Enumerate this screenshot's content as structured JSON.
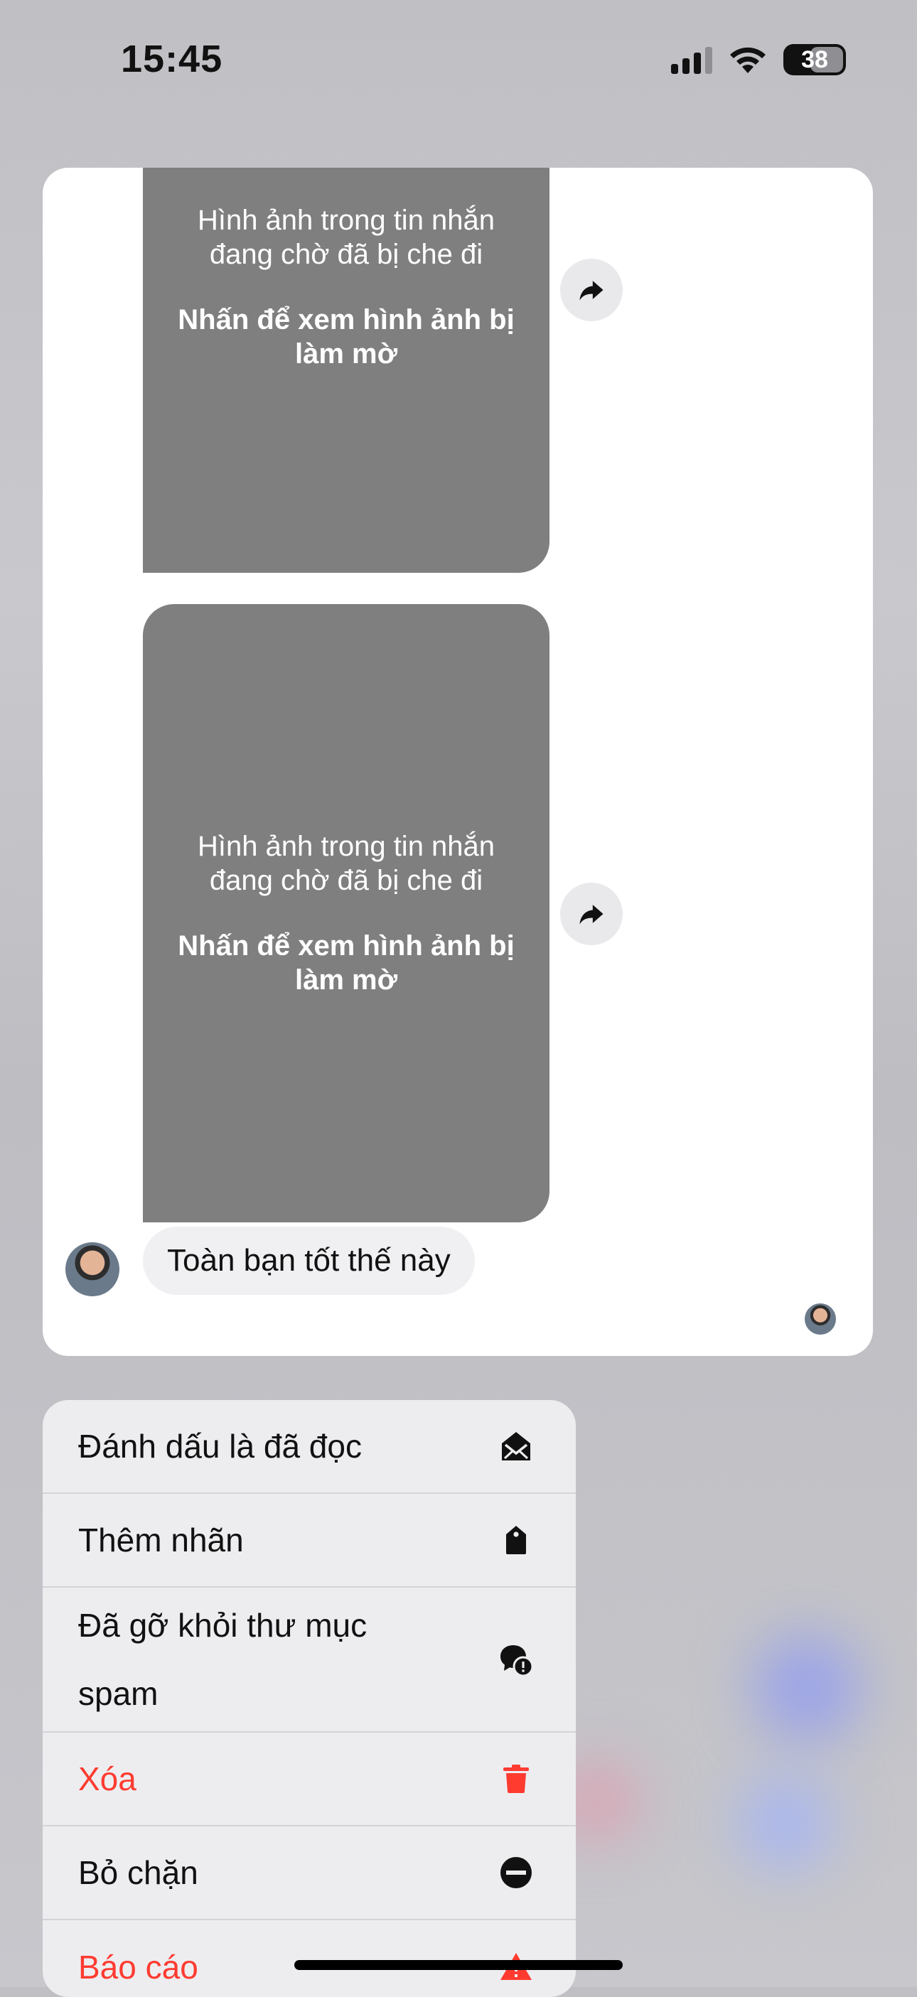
{
  "status_bar": {
    "time": "15:45",
    "battery_level": "38"
  },
  "preview": {
    "blurred_images": [
      {
        "note": "Hình ảnh trong tin nhắn đang chờ đã bị che đi",
        "action": "Nhấn để xem hình ảnh bị làm mờ"
      },
      {
        "note": "Hình ảnh trong tin nhắn đang chờ đã bị che đi",
        "action": "Nhấn để xem hình ảnh bị làm mờ"
      }
    ],
    "text_message": "Toàn bạn tốt thế này"
  },
  "menu": {
    "items": [
      {
        "label": "Đánh dấu là đã đọc",
        "icon": "envelope-open-icon",
        "destructive": false
      },
      {
        "label": "Thêm nhãn",
        "icon": "tag-icon",
        "destructive": false
      },
      {
        "label": "Đã gỡ khỏi thư mục spam",
        "icon": "chat-bubble-alert-icon",
        "destructive": false
      },
      {
        "label": "Xóa",
        "icon": "trash-icon",
        "destructive": true
      },
      {
        "label": "Bỏ chặn",
        "icon": "minus-circle-icon",
        "destructive": false
      },
      {
        "label": "Báo cáo",
        "icon": "warning-triangle-icon",
        "destructive": true
      }
    ]
  },
  "colors": {
    "destructive": "#ff3b30",
    "blurred_image": "#7f7f7f",
    "menu_background": "#ededf0"
  }
}
